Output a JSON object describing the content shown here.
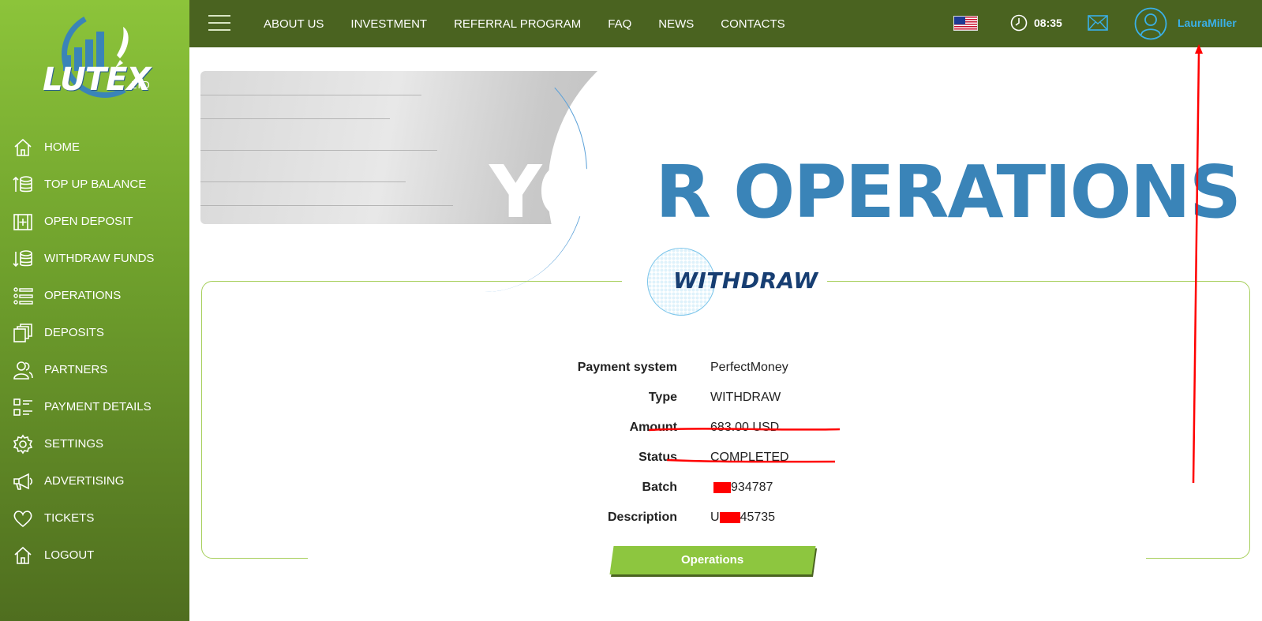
{
  "brand": {
    "logo_text": "LUTEX",
    "logo_suffix": "LTD",
    "accent": "#8cc43a",
    "topbar_color": "#4a6320",
    "title_blue": "#3a84b8"
  },
  "sidebar": {
    "items": [
      {
        "label": "HOME",
        "icon": "home-icon"
      },
      {
        "label": "TOP UP BALANCE",
        "icon": "coins-up-icon"
      },
      {
        "label": "OPEN DEPOSIT",
        "icon": "deposit-add-icon"
      },
      {
        "label": "WITHDRAW FUNDS",
        "icon": "coins-down-icon"
      },
      {
        "label": "OPERATIONS",
        "icon": "list-icon"
      },
      {
        "label": "DEPOSITS",
        "icon": "stack-icon"
      },
      {
        "label": "PARTNERS",
        "icon": "users-icon"
      },
      {
        "label": "PAYMENT DETAILS",
        "icon": "details-icon"
      },
      {
        "label": "SETTINGS",
        "icon": "gear-icon"
      },
      {
        "label": "ADVERTISING",
        "icon": "megaphone-icon"
      },
      {
        "label": "TICKETS",
        "icon": "heart-icon"
      },
      {
        "label": "LOGOUT",
        "icon": "home-icon"
      }
    ]
  },
  "topnav": {
    "links": [
      "ABOUT US",
      "INVESTMENT",
      "REFERRAL PROGRAM",
      "FAQ",
      "NEWS",
      "CONTACTS"
    ],
    "time": "08:35",
    "username": "LauraMiller",
    "flag_icon": "us-flag-icon"
  },
  "banner": {
    "title_white": "YOU",
    "title_blue": "R OPERATIONS"
  },
  "section": {
    "title": "WITHDRAW"
  },
  "details": {
    "rows": [
      {
        "label": "Payment system",
        "value": "PerfectMoney"
      },
      {
        "label": "Type",
        "value": "WITHDRAW"
      },
      {
        "label": "Amount",
        "value": "683.00 USD"
      },
      {
        "label": "Status",
        "value": "COMPLETED"
      },
      {
        "label": "Batch",
        "value_prefix": "",
        "value": "934787"
      },
      {
        "label": "Description",
        "value_prefix": "U",
        "value": "45735"
      }
    ]
  },
  "button": {
    "label": "Operations"
  },
  "annotation_color": "#ff0000"
}
